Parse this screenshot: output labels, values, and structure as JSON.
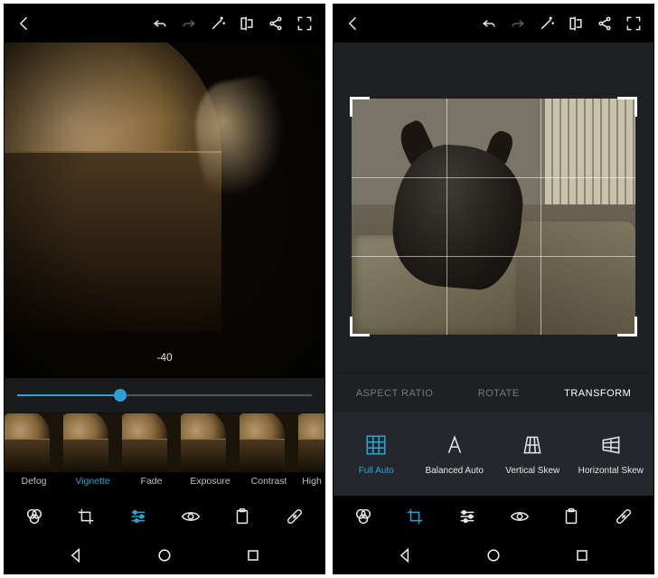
{
  "screen1": {
    "value_label": "-40",
    "slider_percent": 35,
    "presets": [
      {
        "label": "Defog",
        "active": false
      },
      {
        "label": "Vignette",
        "active": true
      },
      {
        "label": "Fade",
        "active": false
      },
      {
        "label": "Exposure",
        "active": false
      },
      {
        "label": "Contrast",
        "active": false
      },
      {
        "label": "High",
        "active": false
      }
    ],
    "active_mode": "adjust"
  },
  "screen2": {
    "tabs": [
      {
        "label": "ASPECT RATIO",
        "active": false
      },
      {
        "label": "ROTATE",
        "active": false
      },
      {
        "label": "TRANSFORM",
        "active": true
      }
    ],
    "options": [
      {
        "label": "Full Auto",
        "key": "full-auto",
        "active": true
      },
      {
        "label": "Balanced Auto",
        "key": "balanced-auto",
        "active": false
      },
      {
        "label": "Vertical Skew",
        "key": "vertical-skew",
        "active": false
      },
      {
        "label": "Horizontal Skew",
        "key": "horizontal-skew",
        "active": false
      }
    ],
    "active_mode": "crop"
  },
  "toolbar_icons": [
    "back",
    "undo",
    "redo",
    "magic",
    "compare",
    "share",
    "fullscreen"
  ],
  "modes": [
    "looks",
    "crop",
    "adjust",
    "redeye",
    "clipboard",
    "heal"
  ]
}
